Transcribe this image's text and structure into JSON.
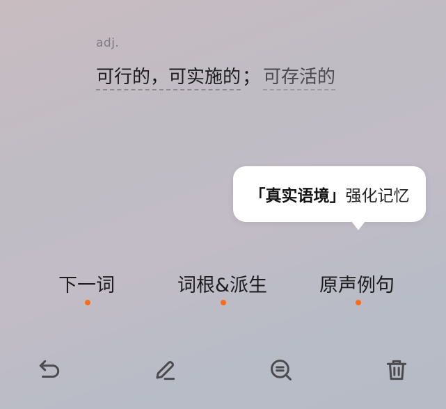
{
  "word": {
    "part_of_speech": "adj.",
    "definition_primary": "可行的，可实施的",
    "definition_separator": "；",
    "definition_secondary": "可存活的"
  },
  "tooltip": {
    "highlight": "「真实语境」",
    "text": "强化记忆"
  },
  "actions": {
    "next_word": "下一词",
    "roots": "词根&派生",
    "examples": "原声例句"
  },
  "toolbar": {
    "icons": [
      "undo-icon",
      "edit-icon",
      "search-icon",
      "trash-icon"
    ]
  },
  "colors": {
    "accent": "#ff6a1a",
    "icon": "#4a4a4f"
  }
}
